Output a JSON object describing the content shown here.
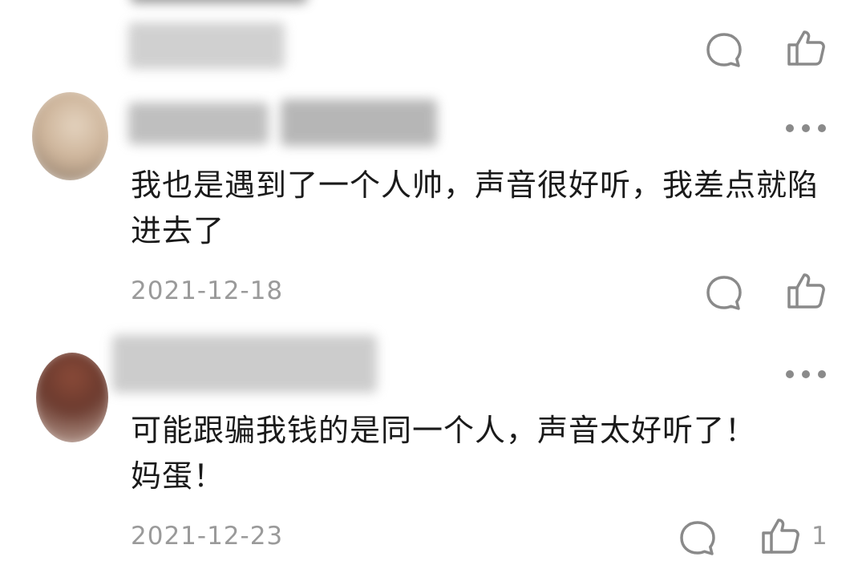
{
  "colors": {
    "text": "#1a1a1a",
    "meta": "#9a9a9a",
    "icon": "#8a8a8a"
  },
  "comments": [
    {
      "username": "",
      "text": "",
      "date": "",
      "like_count": ""
    },
    {
      "username": "",
      "text": "我也是遇到了一个人帅，声音很好听，我差点就陷进去了",
      "date": "2021-12-18",
      "like_count": ""
    },
    {
      "username": "",
      "text": "可能跟骗我钱的是同一个人，声音太好听了！妈蛋！",
      "date": "2021-12-23",
      "like_count": "1"
    }
  ],
  "icons": {
    "reply": "reply-bubble-icon",
    "like": "thumbs-up-icon",
    "more": "more-dots-icon"
  }
}
